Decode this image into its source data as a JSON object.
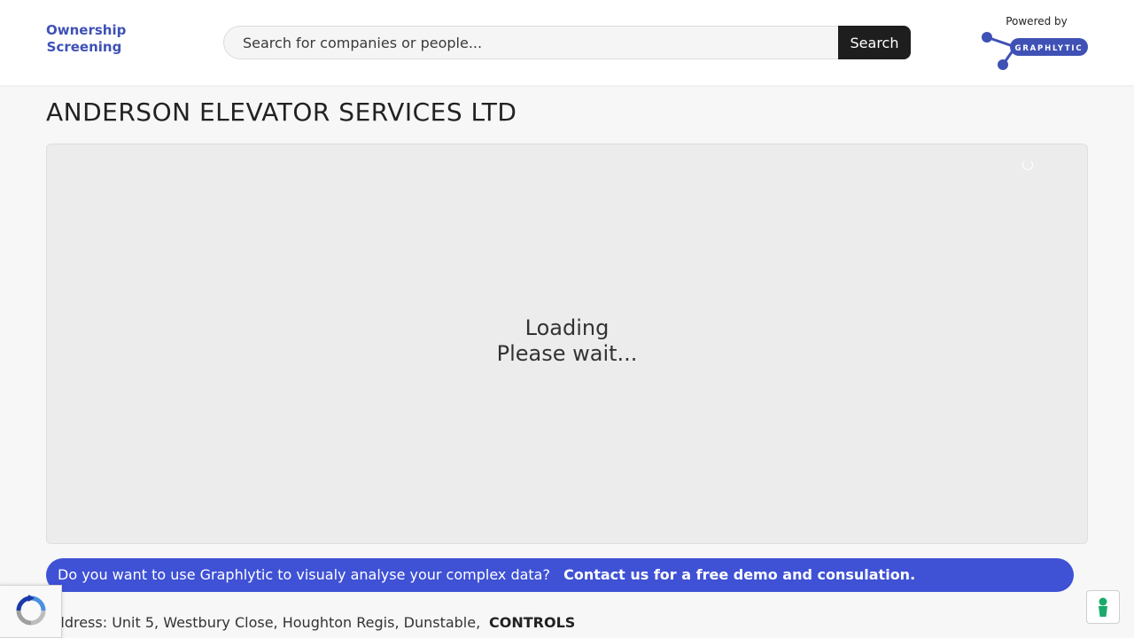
{
  "header": {
    "brand_line1": "Ownership",
    "brand_line2": "Screening",
    "search": {
      "placeholder": "Search for companies or people...",
      "value": "",
      "button_label": "Search"
    },
    "powered_by": "Powered by",
    "logo_text": "GRAPHLYTIC"
  },
  "company": {
    "title": "ANDERSON ELEVATOR SERVICES LTD"
  },
  "graph_panel": {
    "loading_line1": "Loading",
    "loading_line2": "Please wait..."
  },
  "cta_banner": {
    "question": "Do you want to use Graphlytic to visualy analyse your complex data?",
    "link": "Contact us for a free demo and consulation."
  },
  "details": {
    "address": "Address: Unit 5, Westbury Close, Houghton Regis, Dunstable,",
    "controls_label": "CONTROLS"
  },
  "icons": {
    "spinner": "loading-spinner-icon",
    "recaptcha": "recaptcha-icon",
    "cookie": "cookie-settings-icon",
    "logo": "graphlytic-logo-icon"
  },
  "colors": {
    "brand": "#3f51b5",
    "banner": "#3f51d5",
    "search_button": "#1e1e1e",
    "cookie_icon": "#1aab6a"
  }
}
